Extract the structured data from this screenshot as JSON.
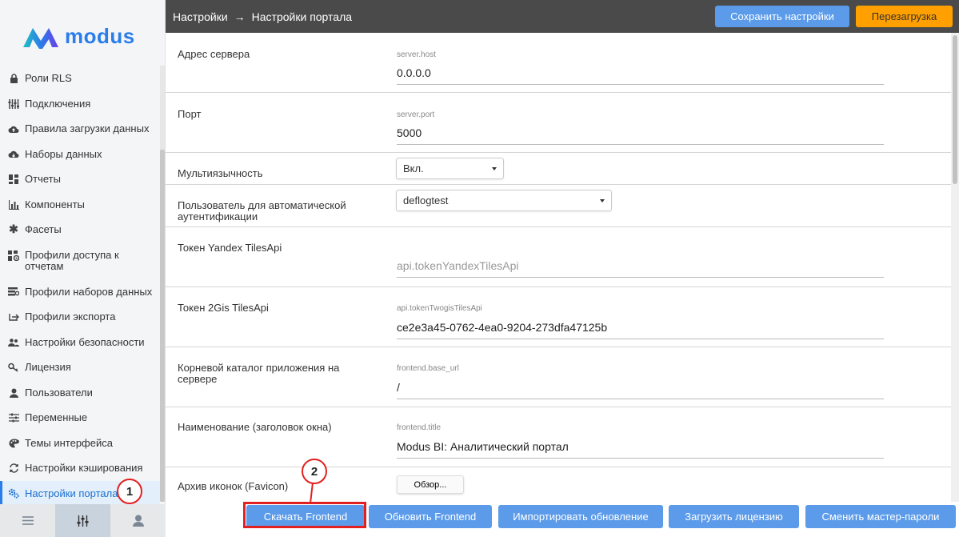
{
  "app": {
    "logo_text": "modus"
  },
  "header": {
    "breadcrumb": [
      "Настройки",
      "→",
      "Настройки портала"
    ],
    "save_label": "Сохранить настройки",
    "reload_label": "Перезагрузка"
  },
  "sidebar": {
    "items": [
      {
        "label": "Роли RLS",
        "icon": "lock-icon"
      },
      {
        "label": "Подключения",
        "icon": "sliders-icon"
      },
      {
        "label": "Правила загрузки данных",
        "icon": "cloud-upload-icon"
      },
      {
        "label": "Наборы данных",
        "icon": "cloud-icon"
      },
      {
        "label": "Отчеты",
        "icon": "dashboard-icon"
      },
      {
        "label": "Компоненты",
        "icon": "bar-chart-icon"
      },
      {
        "label": "Фасеты",
        "icon": "asterisk-icon"
      },
      {
        "label": "Профили доступа к отчетам",
        "icon": "report-access-icon"
      },
      {
        "label": "Профили наборов данных",
        "icon": "dataset-profile-icon"
      },
      {
        "label": "Профили экспорта",
        "icon": "export-icon"
      },
      {
        "label": "Настройки безопасности",
        "icon": "users-icon"
      },
      {
        "label": "Лицензия",
        "icon": "key-icon"
      },
      {
        "label": "Пользователи",
        "icon": "user-icon"
      },
      {
        "label": "Переменные",
        "icon": "variables-icon"
      },
      {
        "label": "Темы интерфейса",
        "icon": "palette-icon"
      },
      {
        "label": "Настройки кэширования",
        "icon": "refresh-icon"
      },
      {
        "label": "Настройки портала",
        "icon": "gears-icon",
        "active": true
      }
    ],
    "bottom": [
      "menu-icon",
      "settings-sliders-icon",
      "profile-icon"
    ]
  },
  "settings": {
    "server_host": {
      "label": "Адрес сервера",
      "hint": "server.host",
      "value": "0.0.0.0"
    },
    "server_port": {
      "label": "Порт",
      "hint": "server.port",
      "value": "5000"
    },
    "multilang": {
      "label": "Мультиязычность",
      "value": "Вкл."
    },
    "auto_user": {
      "label": "Пользователь для автоматической аутентификации",
      "value": "deflogtest"
    },
    "yandex_token": {
      "label": "Токен Yandex TilesApi",
      "placeholder": "api.tokenYandexTilesApi"
    },
    "twogis_token": {
      "label": "Токен 2Gis TilesApi",
      "hint": "api.tokenTwogisTilesApi",
      "value": "ce2e3a45-0762-4ea0-9204-273dfa47125b"
    },
    "base_url": {
      "label": "Корневой каталог приложения на сервере",
      "hint": "frontend.base_url",
      "value": "/"
    },
    "title": {
      "label": "Наименование (заголовок окна)",
      "hint": "frontend.title",
      "value": "Modus BI: Аналитический портал"
    },
    "favicon": {
      "label": "Архив иконок (Favicon)",
      "browse_label": "Обзор..."
    }
  },
  "footer": {
    "download_frontend": "Скачать Frontend",
    "update_frontend": "Обновить Frontend",
    "import_update": "Импортировать обновление",
    "upload_license": "Загрузить лицензию",
    "change_master": "Сменить мастер-пароли"
  },
  "annotations": {
    "marker_1": "1",
    "marker_2": "2"
  },
  "colors": {
    "accent": "#5b9bea",
    "warning": "#ffa000",
    "header_bg": "#4a4a4a",
    "annotation": "#e32020"
  }
}
